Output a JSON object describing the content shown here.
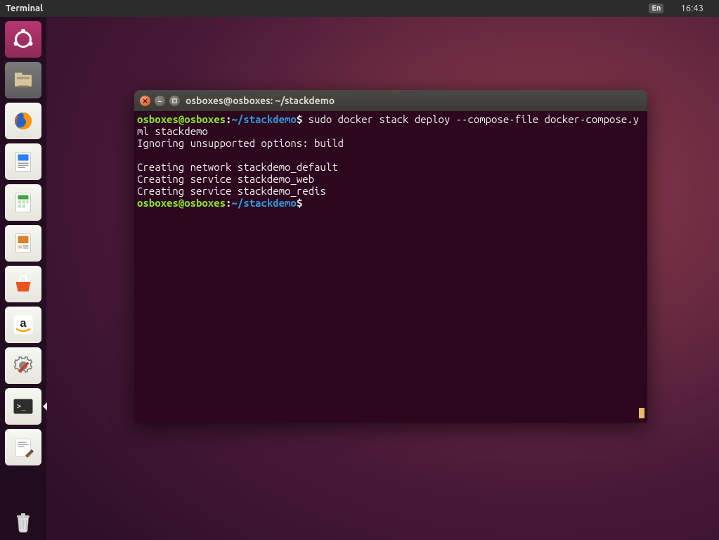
{
  "top_panel": {
    "app_name": "Terminal",
    "lang": "En",
    "time": "16:43"
  },
  "launcher": {
    "items": [
      {
        "name": "ubuntu-dash"
      },
      {
        "name": "files"
      },
      {
        "name": "firefox"
      },
      {
        "name": "libreoffice-writer"
      },
      {
        "name": "libreoffice-calc"
      },
      {
        "name": "libreoffice-impress"
      },
      {
        "name": "ubuntu-software"
      },
      {
        "name": "amazon"
      },
      {
        "name": "system-settings"
      },
      {
        "name": "terminal"
      },
      {
        "name": "text-editor"
      }
    ],
    "trash": {
      "name": "trash"
    }
  },
  "window": {
    "title": "osboxes@osboxes: ~/stackdemo",
    "prompt1_user": "osboxes@osboxes",
    "prompt1_path": "~/stackdemo",
    "command1": "sudo docker stack deploy --compose-file docker-compose.yml stackdemo",
    "output_line1": "Ignoring unsupported options: build",
    "output_line2": "",
    "output_line3": "Creating network stackdemo_default",
    "output_line4": "Creating service stackdemo_web",
    "output_line5": "Creating service stackdemo_redis",
    "prompt2_user": "osboxes@osboxes",
    "prompt2_path": "~/stackdemo"
  }
}
